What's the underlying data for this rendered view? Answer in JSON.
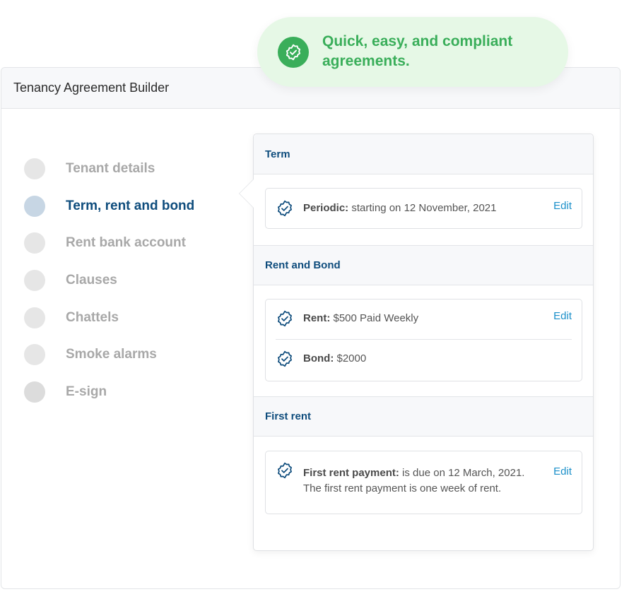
{
  "colors": {
    "brand_green": "#3aae5a",
    "toast_bg": "#e6f8e6",
    "heading_blue": "#0f4d7d",
    "link_blue": "#1a8fc9",
    "inactive_grey": "#a8a8a8"
  },
  "toast": {
    "icon": "badge-check-icon",
    "text": "Quick, easy, and compliant agreements."
  },
  "builder": {
    "title": "Tenancy Agreement Builder"
  },
  "steps": [
    {
      "label": "Tenant details",
      "active": false
    },
    {
      "label": "Term, rent and bond",
      "active": true
    },
    {
      "label": "Rent bank account",
      "active": false
    },
    {
      "label": "Clauses",
      "active": false
    },
    {
      "label": "Chattels",
      "active": false
    },
    {
      "label": "Smoke alarms",
      "active": false
    },
    {
      "label": "E-sign",
      "active": false
    }
  ],
  "panel": {
    "edit_label": "Edit",
    "term": {
      "header": "Term",
      "label": "Periodic:",
      "value": " starting on 12 November, 2021"
    },
    "rent_bond": {
      "header": "Rent and Bond",
      "rent_label": "Rent:",
      "rent_value": " $500 Paid Weekly",
      "bond_label": "Bond:",
      "bond_value": " $2000"
    },
    "first_rent": {
      "header": "First rent",
      "label": "First rent payment:",
      "value": " is due on 12 March, 2021.",
      "note": "The first rent payment is one week of rent."
    }
  }
}
